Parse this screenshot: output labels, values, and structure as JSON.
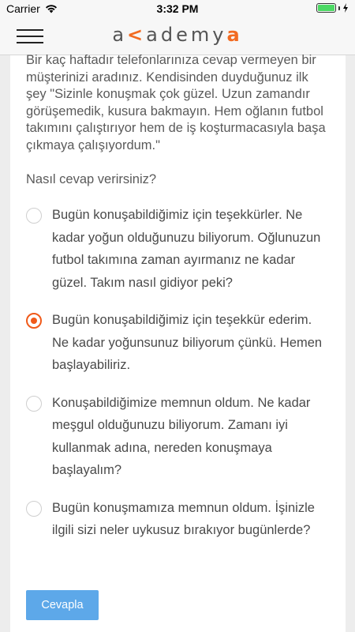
{
  "status_bar": {
    "carrier": "Carrier",
    "time": "3:32 PM"
  },
  "header": {
    "logo_prefix": "a",
    "logo_accent_1": "<",
    "logo_middle": "ademy",
    "logo_accent_2": "a"
  },
  "scenario_text": "Bir kaç haftadır telefonlarınıza cevap vermeyen bir müşterinizi aradınız. Kendisinden duyduğunuz ilk şey \"Sizinle konuşmak çok güzel. Uzun zamandır görüşemedik, kusura bakmayın. Hem oğlanın futbol takımını çalıştırıyor hem de iş koşturmacasıyla başa çıkmaya çalışıyordum.\"",
  "question": "Nasıl cevap verirsiniz?",
  "options": [
    {
      "label": "Bugün konuşabildiğimiz için teşekkürler. Ne kadar yoğun olduğunuzu biliyorum. Oğlunuzun futbol takımına zaman ayırmanız ne kadar güzel. Takım nasıl gidiyor peki?",
      "selected": false
    },
    {
      "label": "Bugün konuşabildiğimiz için teşekkür ederim. Ne kadar yoğunsunuz biliyorum çünkü. Hemen başlayabiliriz.",
      "selected": true
    },
    {
      "label": "Konuşabildiğimize memnun oldum. Ne kadar meşgul olduğunuzu biliyorum. Zamanı iyi kullanmak adına, nereden konuşmaya başlayalım?",
      "selected": false
    },
    {
      "label": "Bugün konuşmamıza memnun oldum. İşinizle ilgili sizi neler uykusuz bırakıyor bugünlerde?",
      "selected": false
    }
  ],
  "submit_label": "Cevapla",
  "colors": {
    "accent": "#f05a1a",
    "button": "#5da8e9",
    "battery": "#4cd964"
  }
}
